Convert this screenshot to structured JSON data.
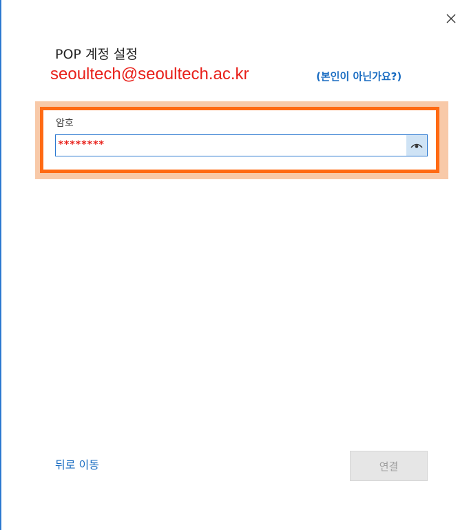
{
  "window": {
    "close_icon": "close-icon",
    "title": "POP 계정 설정"
  },
  "account": {
    "email": "seoultech@seoultech.ac.kr",
    "not_you_link": "(본인이 아닌가요?)"
  },
  "password": {
    "label": "암호",
    "value": "********",
    "reveal_icon": "eye-icon"
  },
  "footer": {
    "back_link": "뒤로 이동",
    "connect_button": "연결",
    "connect_enabled": false
  },
  "colors": {
    "accent": "#1a6dc2",
    "annotation_red": "#e8201a",
    "highlight_orange": "#ff6a13",
    "highlight_glow": "#f8c9a8"
  }
}
